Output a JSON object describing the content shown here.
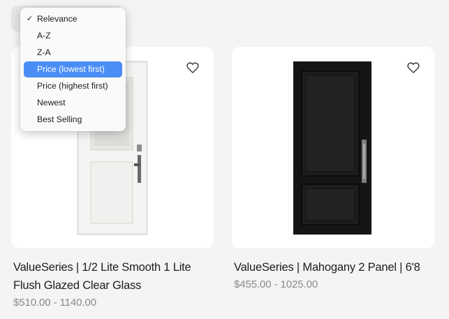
{
  "sort_menu": {
    "items": [
      {
        "label": "Relevance",
        "checked": true,
        "highlighted": false
      },
      {
        "label": "A-Z",
        "checked": false,
        "highlighted": false
      },
      {
        "label": "Z-A",
        "checked": false,
        "highlighted": false
      },
      {
        "label": "Price (lowest first)",
        "checked": false,
        "highlighted": true
      },
      {
        "label": "Price (highest first)",
        "checked": false,
        "highlighted": false
      },
      {
        "label": "Newest",
        "checked": false,
        "highlighted": false
      },
      {
        "label": "Best Selling",
        "checked": false,
        "highlighted": false
      }
    ],
    "checkmark": "✓",
    "highlight_color": "#4a8ef5"
  },
  "products": [
    {
      "title_line1": "ValueSeries | 1/2 Lite Smooth 1 Lite",
      "title_line2": "Flush Glazed Clear Glass",
      "price": "$510.00 - 1140.00",
      "door_color": "#f3f3f1",
      "icon": "heart-icon"
    },
    {
      "title_line1": "ValueSeries | Mahogany 2 Panel | 6'8",
      "price": "$455.00 - 1025.00",
      "door_color": "#1c1c1c",
      "icon": "heart-icon"
    }
  ]
}
